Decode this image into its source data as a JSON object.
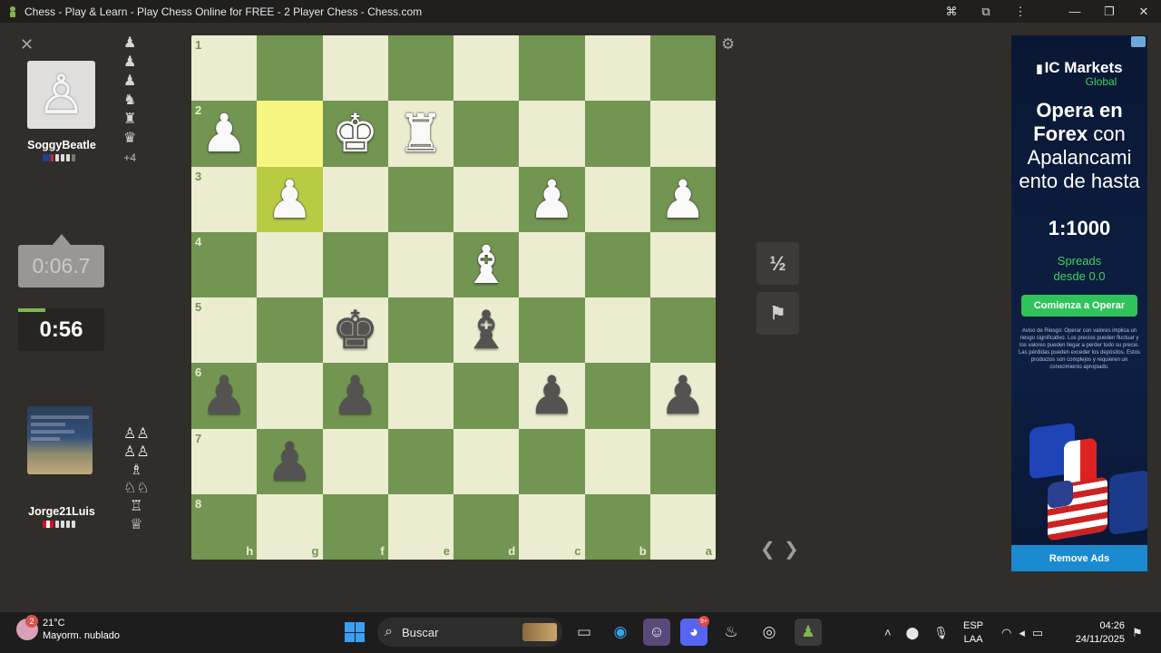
{
  "window": {
    "title": "Chess - Play & Learn - Play Chess Online for FREE - 2 Player Chess - Chess.com"
  },
  "top_player": {
    "username": "SoggyBeatle",
    "captured": [
      "♟",
      "♟",
      "♟",
      "♟",
      "♟",
      "♟"
    ],
    "captured_more": "+4",
    "clock": "0:06.7",
    "flag_colors": [
      "#1f3f8f",
      "#d22"
    ]
  },
  "bottom_player": {
    "username": "Jorge21Luis",
    "captured": [
      "♙♙",
      "♙♙",
      "♗",
      "♘♘",
      "♖",
      "♕"
    ],
    "clock": "0:56",
    "flag_colors": [
      "#d91023",
      "#ffffff"
    ]
  },
  "board": {
    "ranks": [
      "1",
      "2",
      "3",
      "4",
      "5",
      "6",
      "7",
      "8"
    ],
    "files": [
      "h",
      "g",
      "f",
      "e",
      "d",
      "c",
      "b",
      "a"
    ],
    "rows": [
      [
        "",
        "",
        "",
        "",
        "",
        "",
        "",
        ""
      ],
      [
        "wp",
        "hl",
        "wk",
        "wr",
        "",
        "",
        "",
        ""
      ],
      [
        "",
        "wp*",
        "",
        "",
        "",
        "wp",
        "",
        "wp"
      ],
      [
        "",
        "",
        "",
        "",
        "wb",
        "",
        "",
        ""
      ],
      [
        "",
        "",
        "bk",
        "",
        "bb",
        "",
        "",
        ""
      ],
      [
        "bp",
        "",
        "bp",
        "",
        "",
        "bp",
        "",
        "bp"
      ],
      [
        "",
        "bp",
        "",
        "",
        "",
        "",
        "",
        ""
      ],
      [
        "",
        "",
        "",
        "",
        "",
        "",
        "",
        ""
      ]
    ]
  },
  "controls": {
    "draw_label": "½",
    "resign_label": "⚑",
    "gear_icon": "⚙",
    "prev_arrow": "❮",
    "next_arrow": "❯",
    "close_icon": "✕"
  },
  "ad": {
    "brand": "IC Markets",
    "brand_sub": "Global",
    "headline_1": "Opera en",
    "headline_2": "Forex",
    "headline_3": "con Apalancami ento de hasta",
    "ratio": "1:1000",
    "spreads_1": "Spreads",
    "spreads_2": "desde 0.0",
    "cta": "Comienza a Operar",
    "warning": "Aviso de Riesgo: Operar con valores implica un riesgo significativo. Los precios pueden fluctuar y los valores pueden llegar a perder todo su precio. Las pérdidas pueden exceder los depósitos. Estos productos son complejos y requieren un conocimiento apropiado.",
    "remove_ads": "Remove Ads"
  },
  "taskbar": {
    "temperature": "21°C",
    "weather_desc": "Mayorm. nublado",
    "weather_badge": "2",
    "search_placeholder": "Buscar",
    "language_1": "ESP",
    "language_2": "LAA",
    "time": "04:26",
    "date": "24/11/2025",
    "discord_badge": "9+"
  }
}
